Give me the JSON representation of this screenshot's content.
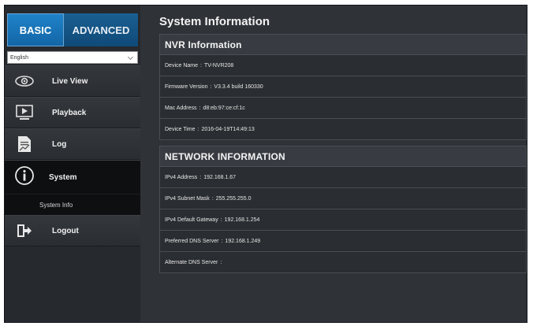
{
  "tabs": {
    "basic": "BASIC",
    "advanced": "ADVANCED"
  },
  "language": {
    "selected": "English"
  },
  "menu": {
    "live_view": "Live View",
    "playback": "Playback",
    "log": "Log",
    "system": "System",
    "system_info": "System Info",
    "logout": "Logout"
  },
  "page": {
    "title": "System Information"
  },
  "nvr": {
    "title": "NVR Information",
    "rows": [
      {
        "label": "Device Name",
        "value": "TV-NVR208"
      },
      {
        "label": "Firmware Version",
        "value": "V3.3.4 build 160330"
      },
      {
        "label": "Mac Address",
        "value": "d8:eb:97:ce:cf:1c"
      },
      {
        "label": "Device Time",
        "value": "2016-04-19T14:49:13"
      }
    ]
  },
  "network": {
    "title": "NETWORK INFORMATION",
    "rows": [
      {
        "label": "IPv4 Address",
        "value": "192.168.1.67"
      },
      {
        "label": "IPv4 Subnet Mask",
        "value": "255.255.255.0"
      },
      {
        "label": "IPv4 Default Gateway",
        "value": "192.168.1.254"
      },
      {
        "label": "Preferred DNS Server",
        "value": "192.168.1.249"
      },
      {
        "label": "Alternate DNS Server",
        "value": ""
      }
    ]
  },
  "colors": {
    "accent": "#1670b3",
    "background": "#2b2e33",
    "active": "#0e0f11"
  }
}
